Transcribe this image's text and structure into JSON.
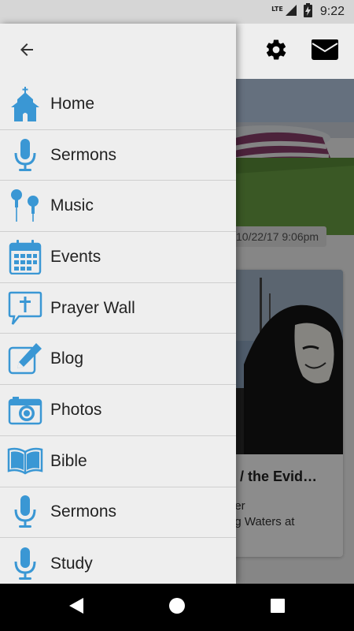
{
  "status_bar": {
    "network": "LTE",
    "time": "9:22"
  },
  "drawer": {
    "back_icon": "arrow-left-icon",
    "items": [
      {
        "label": "Home",
        "icon": "church-icon"
      },
      {
        "label": "Sermons",
        "icon": "microphone-icon"
      },
      {
        "label": "Music",
        "icon": "earbuds-icon"
      },
      {
        "label": "Events",
        "icon": "calendar-icon"
      },
      {
        "label": "Prayer Wall",
        "icon": "prayer-bubble-icon"
      },
      {
        "label": "Blog",
        "icon": "edit-icon"
      },
      {
        "label": "Photos",
        "icon": "camera-icon"
      },
      {
        "label": "Bible",
        "icon": "open-book-icon"
      },
      {
        "label": "Sermons",
        "icon": "microphone-icon"
      },
      {
        "label": "Study",
        "icon": "microphone-icon"
      }
    ]
  },
  "header_actions": {
    "settings_icon": "gear-icon",
    "mail_icon": "envelope-icon"
  },
  "background_feed": {
    "date": "10/22/17 9:06pm",
    "post_title": "s / the Evid…",
    "post_excerpt_line1": "her",
    "post_excerpt_line2": "ng Waters at"
  },
  "colors": {
    "icon_blue": "#3a97d4",
    "drawer_bg": "#eeeeee",
    "status_bar": "#d6d6d6",
    "nav_bar": "#000000"
  },
  "nav_bar": {
    "back": "back-triangle-icon",
    "home": "home-circle-icon",
    "recents": "recents-square-icon"
  }
}
